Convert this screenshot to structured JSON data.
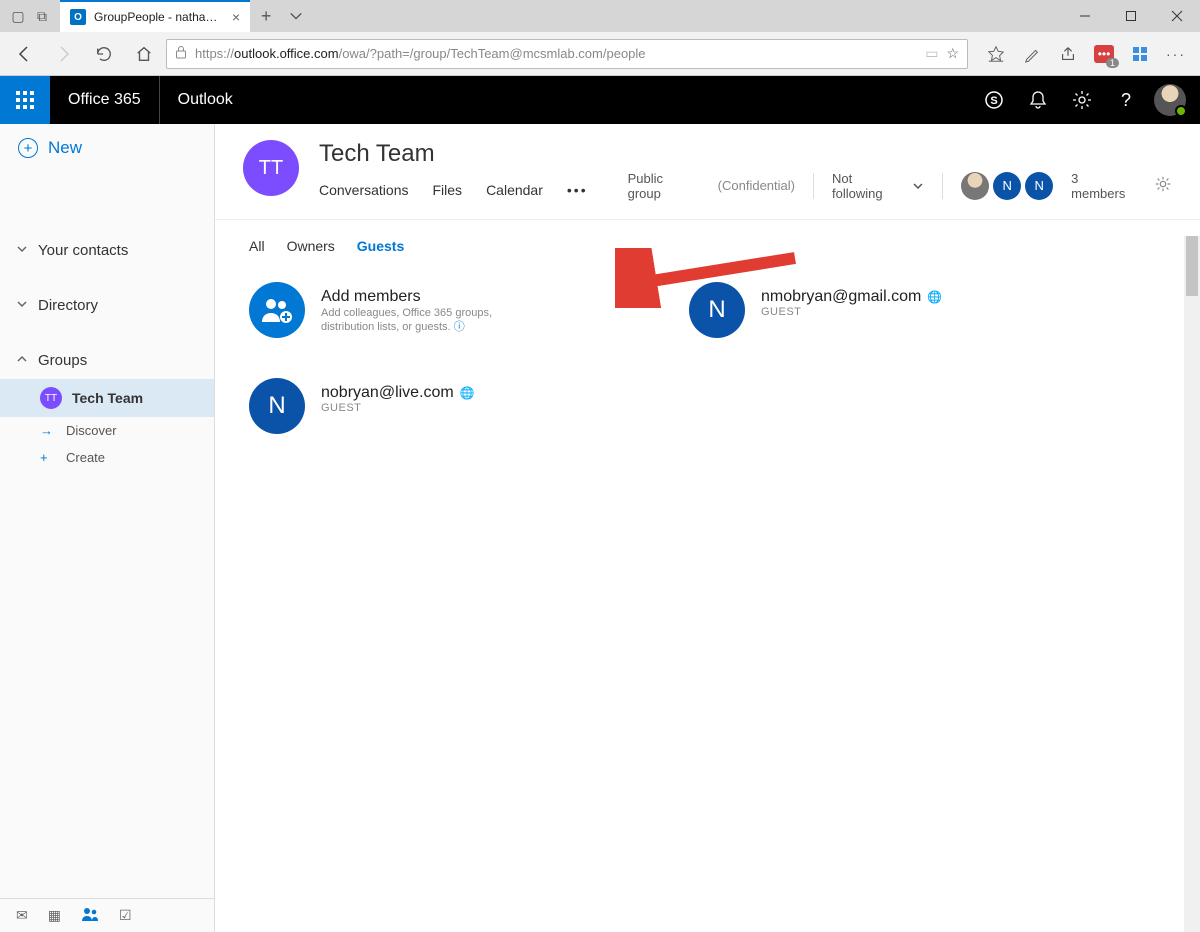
{
  "browser": {
    "tab_title": "GroupPeople - nathan@",
    "url_prefix": "https://",
    "url_host": "outlook.office.com",
    "url_path": "/owa/?path=/group/TechTeam@mcsmlab.com/people",
    "ext_badge": "1"
  },
  "o365": {
    "brand": "Office 365",
    "app": "Outlook"
  },
  "nav": {
    "new": "New",
    "contacts": "Your contacts",
    "directory": "Directory",
    "groups": "Groups",
    "techteam": "Tech Team",
    "discover": "Discover",
    "create": "Create"
  },
  "group": {
    "initials": "TT",
    "name": "Tech Team",
    "tab_conversations": "Conversations",
    "tab_files": "Files",
    "tab_calendar": "Calendar",
    "visibility": "Public group",
    "confidential": "(Confidential)",
    "follow": "Not following",
    "member_count": "3 members"
  },
  "filters": {
    "all": "All",
    "owners": "Owners",
    "guests": "Guests"
  },
  "cards": {
    "add_title": "Add members",
    "add_sub": "Add colleagues, Office 365 groups, distribution lists, or guests.",
    "guest_tag": "GUEST",
    "m1_initial": "N",
    "m1_email": "nmobryan@gmail.com",
    "m2_initial": "N",
    "m2_email": "nobryan@live.com"
  }
}
